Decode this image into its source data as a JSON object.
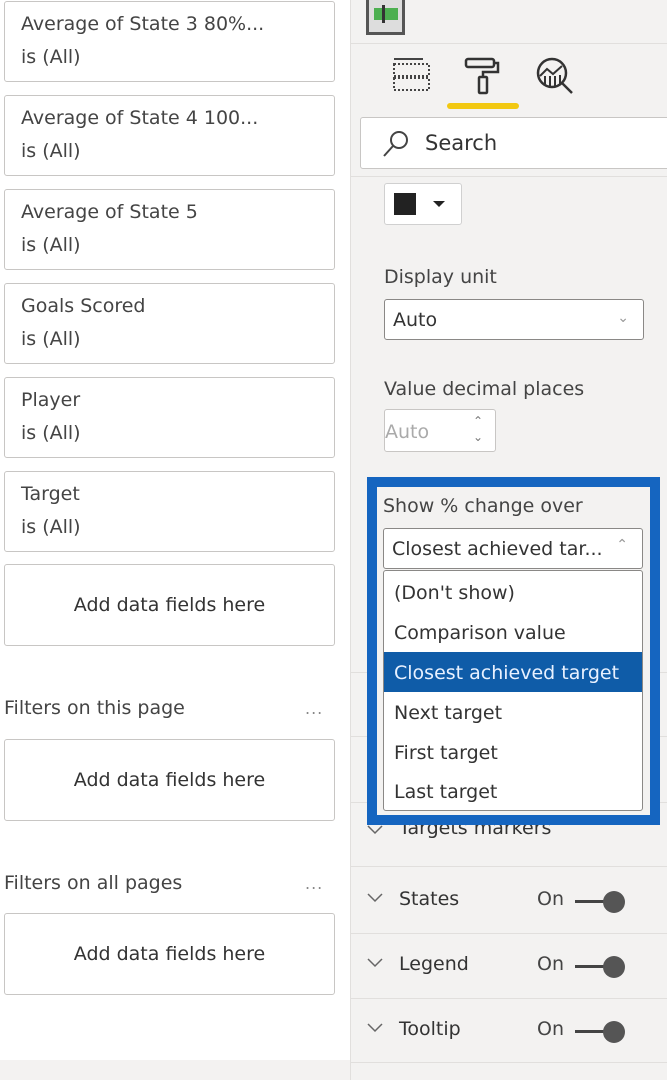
{
  "filters_visual": [
    {
      "field": "Average of State 3 80%...",
      "condition": "is (All)"
    },
    {
      "field": "Average of State 4 100...",
      "condition": "is (All)"
    },
    {
      "field": "Average of State 5",
      "condition": "is (All)"
    },
    {
      "field": "Goals Scored",
      "condition": "is (All)"
    },
    {
      "field": "Player",
      "condition": "is (All)"
    },
    {
      "field": "Target",
      "condition": "is (All)"
    }
  ],
  "add_fields_label": "Add data fields here",
  "sections": {
    "page": {
      "title": "Filters on this page",
      "more": "..."
    },
    "all": {
      "title": "Filters on all pages",
      "more": "..."
    }
  },
  "format_pane": {
    "tabs": [
      {
        "name": "fields",
        "icon": "fields-icon"
      },
      {
        "name": "format",
        "icon": "paint-roller-icon",
        "active": true
      },
      {
        "name": "analytics",
        "icon": "analytics-icon"
      }
    ],
    "accent_color": "#f2c811",
    "search_placeholder": "Search",
    "font_color": "#222222",
    "display_unit": {
      "label": "Display unit",
      "value": "Auto"
    },
    "decimal_places": {
      "label": "Value decimal places",
      "value": "Auto"
    },
    "percent_change": {
      "label": "Show % change over",
      "value": "Closest achieved tar...",
      "options": [
        "(Don't show)",
        "Comparison value",
        "Closest achieved target",
        "Next target",
        "First target",
        "Last target"
      ],
      "selected_index": 2
    },
    "collapsed_sections": [
      {
        "name": "Targets markers"
      },
      {
        "name": "States",
        "toggle": "On"
      },
      {
        "name": "Legend",
        "toggle": "On"
      },
      {
        "name": "Tooltip",
        "toggle": "On"
      }
    ],
    "highlight_color": "#1565c0"
  }
}
